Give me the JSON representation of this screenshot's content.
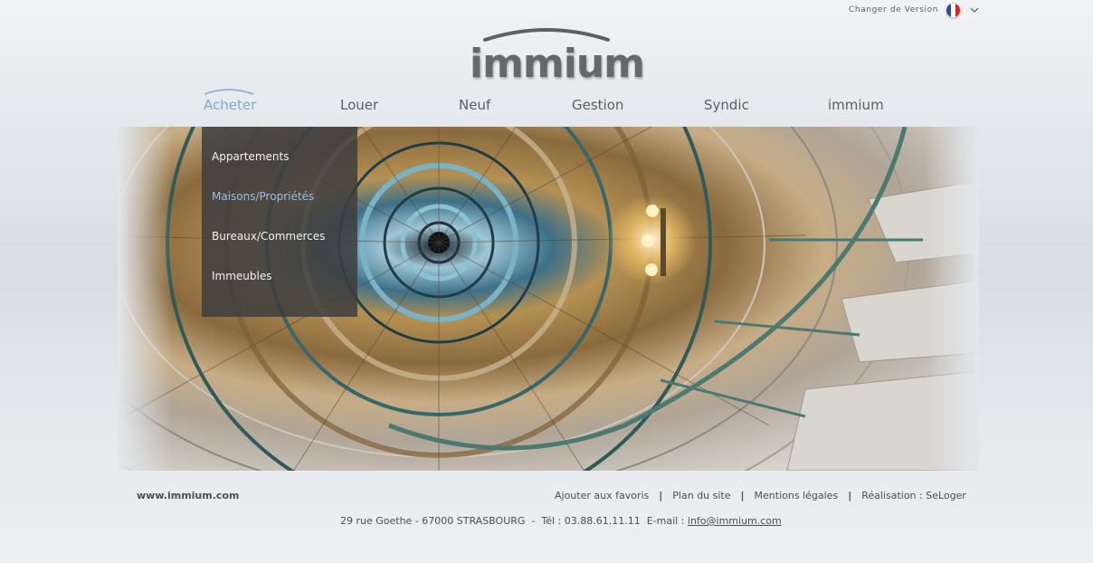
{
  "version_switcher": {
    "label": "Changer de Version",
    "flag_icon": "france-flag-icon",
    "chevron_icon": "chevron-down-icon"
  },
  "logo": {
    "text": "immium"
  },
  "nav": {
    "items": [
      {
        "label": "Acheter",
        "active": true
      },
      {
        "label": "Louer"
      },
      {
        "label": "Neuf"
      },
      {
        "label": "Gestion"
      },
      {
        "label": "Syndic"
      },
      {
        "label": "immium"
      }
    ]
  },
  "dropdown": {
    "items": [
      {
        "label": "Appartements"
      },
      {
        "label": "Maisons/Propriétés",
        "active": true
      },
      {
        "label": "Bureaux/Commerces"
      },
      {
        "label": "Immeubles"
      }
    ]
  },
  "footer": {
    "site": "www.immium.com",
    "links": [
      "Ajouter aux favoris",
      "Plan du site",
      "Mentions légales",
      "Réalisation : SeLoger"
    ],
    "separator": "|",
    "address_prefix": "29 rue Goethe - 67000 STRASBOURG  -  Tél : 03.88.61.11.11  E-mail : ",
    "email": "info@immium.com"
  },
  "colors": {
    "accent": "#86a8d0",
    "nav_text": "#5b5f64",
    "dropdown_bg": "#3e3e3e"
  }
}
